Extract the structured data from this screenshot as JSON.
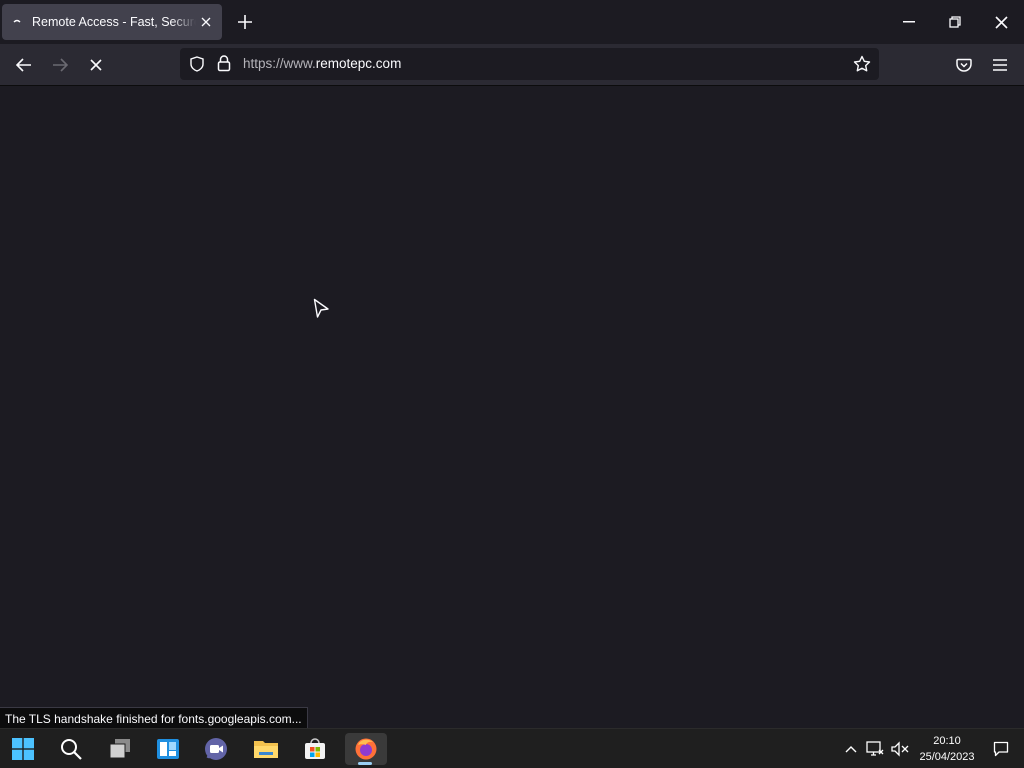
{
  "browser": {
    "tab": {
      "title": "Remote Access - Fast, Secure and Reliable"
    },
    "url": {
      "scheme": "https://www.",
      "domain": "remotepc.com"
    },
    "status_text": "The TLS handshake finished for fonts.googleapis.com..."
  },
  "taskbar": {
    "clock": {
      "time": "20:10",
      "date": "25/04/2023"
    },
    "apps": [
      "start-icon",
      "search-icon",
      "task-view-icon",
      "widgets-icon",
      "teams-chat-icon",
      "file-explorer-icon",
      "microsoft-store-icon",
      "firefox-icon"
    ]
  },
  "colors": {
    "accent": "#9ad0f5",
    "titlebar": "#1c1b22",
    "toolbar": "#2b2a33",
    "tab_active": "#42414d"
  }
}
